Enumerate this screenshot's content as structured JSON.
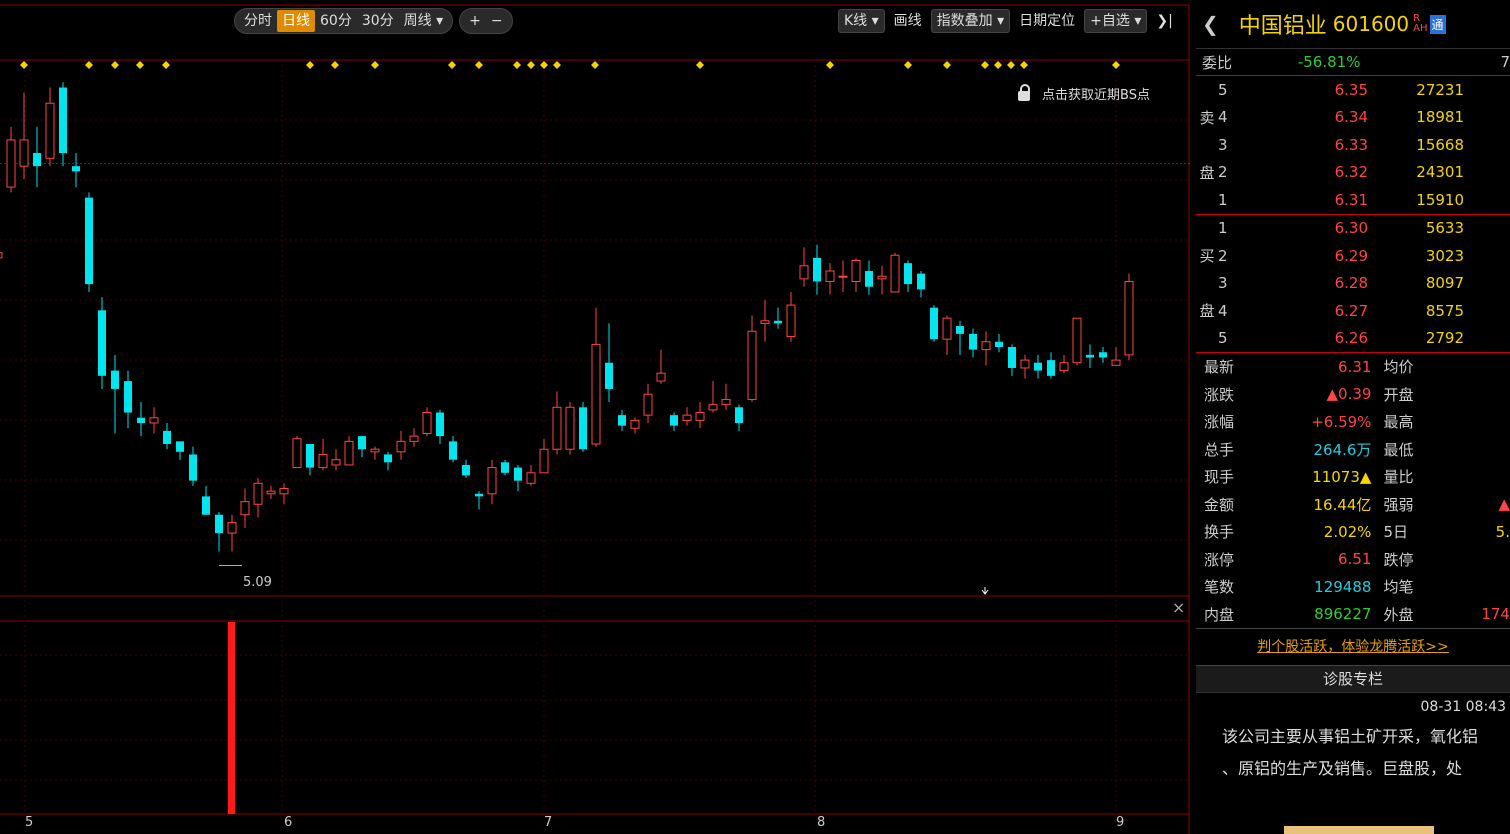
{
  "toolbar": {
    "periods": [
      "分时",
      "日线",
      "60分",
      "30分",
      "周线 ▾"
    ],
    "active_period": "日线",
    "zoom_in": "+",
    "zoom_out": "−",
    "right_buttons": [
      "K线 ▾",
      "画线",
      "指数叠加 ▾",
      "日期定位",
      "+自选 ▾",
      "❯|"
    ]
  },
  "chart": {
    "bs_hint": "点击获取近期BS点",
    "low_label": "5.09",
    "month_labels": [
      "5",
      "6",
      "7",
      "8",
      "9"
    ],
    "close_symbol": "×"
  },
  "stock": {
    "back": "❮",
    "name": "中国铝业",
    "code": "601600",
    "tag_top": "R",
    "tag_bottom": "AH",
    "tong": "通"
  },
  "weibi": {
    "label": "委比",
    "value": "-56.81%",
    "value2": "7"
  },
  "sell": [
    {
      "level": "5",
      "price": "6.35",
      "volume": "27231"
    },
    {
      "level": "4",
      "price": "6.34",
      "volume": "18981"
    },
    {
      "level": "3",
      "price": "6.33",
      "volume": "15668"
    },
    {
      "level": "2",
      "price": "6.32",
      "volume": "24301"
    },
    {
      "level": "1",
      "price": "6.31",
      "volume": "15910"
    }
  ],
  "sell_side_label": [
    "卖",
    "盘"
  ],
  "buy": [
    {
      "level": "1",
      "price": "6.30",
      "volume": "5633"
    },
    {
      "level": "2",
      "price": "6.29",
      "volume": "3023"
    },
    {
      "level": "3",
      "price": "6.28",
      "volume": "8097"
    },
    {
      "level": "4",
      "price": "6.27",
      "volume": "8575"
    },
    {
      "level": "5",
      "price": "6.26",
      "volume": "2792"
    }
  ],
  "buy_side_label": [
    "买",
    "盘"
  ],
  "stats": [
    {
      "k": "最新",
      "v": "6.31",
      "vc": "red",
      "k2": "均价",
      "v2": "",
      "v2c": "red"
    },
    {
      "k": "涨跌",
      "v": "▲0.39",
      "vc": "red",
      "k2": "开盘",
      "v2": "",
      "v2c": "red"
    },
    {
      "k": "涨幅",
      "v": "+6.59%",
      "vc": "red",
      "k2": "最高",
      "v2": "",
      "v2c": "red"
    },
    {
      "k": "总手",
      "v": "264.6万",
      "vc": "cyan",
      "k2": "最低",
      "v2": "",
      "v2c": "red"
    },
    {
      "k": "现手",
      "v": "11073▲",
      "vc": "yellow",
      "k2": "量比",
      "v2": "",
      "v2c": "red"
    },
    {
      "k": "金额",
      "v": "16.44亿",
      "vc": "yellow",
      "k2": "强弱",
      "v2": "▲",
      "v2c": "red"
    },
    {
      "k": "换手",
      "v": "2.02%",
      "vc": "yellow",
      "k2": "5日",
      "v2": "5.",
      "v2c": "yellow"
    },
    {
      "k": "涨停",
      "v": "6.51",
      "vc": "red",
      "k2": "跌停",
      "v2": "",
      "v2c": "green"
    },
    {
      "k": "笔数",
      "v": "129488",
      "vc": "cyan",
      "k2": "均笔",
      "v2": "",
      "v2c": "yellow"
    },
    {
      "k": "内盘",
      "v": "896227",
      "vc": "green",
      "k2": "外盘",
      "v2": "174",
      "v2c": "red"
    }
  ],
  "promo": "判个股活跃，体验龙腾活跃>>",
  "column": {
    "title": "诊股专栏",
    "date": "08-31 08:43",
    "lines": [
      "该公司主要从事铝土矿开采，氧化铝",
      "、原铝的生产及销售。巨盘股，处"
    ]
  },
  "chart_data": {
    "type": "candlestick",
    "candles": [
      {
        "o": 5.95,
        "c": 5.97,
        "h": 6.05,
        "l": 5.9
      },
      {
        "o": 6.22,
        "c": 6.4,
        "h": 6.45,
        "l": 6.2
      },
      {
        "o": 6.3,
        "c": 6.4,
        "h": 6.58,
        "l": 6.25
      },
      {
        "o": 6.35,
        "c": 6.3,
        "h": 6.45,
        "l": 6.22
      },
      {
        "o": 6.33,
        "c": 6.54,
        "h": 6.6,
        "l": 6.3
      },
      {
        "o": 6.6,
        "c": 6.35,
        "h": 6.62,
        "l": 6.3
      },
      {
        "o": 6.3,
        "c": 6.28,
        "h": 6.35,
        "l": 6.22
      },
      {
        "o": 6.18,
        "c": 5.85,
        "h": 6.2,
        "l": 5.82
      },
      {
        "o": 5.75,
        "c": 5.5,
        "h": 5.8,
        "l": 5.45
      },
      {
        "o": 5.52,
        "c": 5.45,
        "h": 5.58,
        "l": 5.28
      },
      {
        "o": 5.48,
        "c": 5.36,
        "h": 5.52,
        "l": 5.3
      },
      {
        "o": 5.34,
        "c": 5.32,
        "h": 5.4,
        "l": 5.27
      },
      {
        "o": 5.32,
        "c": 5.34,
        "h": 5.38,
        "l": 5.28
      },
      {
        "o": 5.29,
        "c": 5.24,
        "h": 5.32,
        "l": 5.22
      },
      {
        "o": 5.25,
        "c": 5.21,
        "h": 5.25,
        "l": 5.18
      },
      {
        "o": 5.2,
        "c": 5.1,
        "h": 5.23,
        "l": 5.08
      },
      {
        "o": 5.04,
        "c": 4.97,
        "h": 5.08,
        "l": 4.97
      },
      {
        "o": 4.97,
        "c": 4.9,
        "h": 4.98,
        "l": 4.83
      },
      {
        "o": 4.9,
        "c": 4.94,
        "h": 4.97,
        "l": 4.83
      },
      {
        "o": 4.97,
        "c": 5.02,
        "h": 5.07,
        "l": 4.92
      },
      {
        "o": 5.01,
        "c": 5.09,
        "h": 5.11,
        "l": 4.96
      },
      {
        "o": 5.05,
        "c": 5.06,
        "h": 5.08,
        "l": 5.03
      },
      {
        "o": 5.05,
        "c": 5.07,
        "h": 5.09,
        "l": 5.01
      },
      {
        "o": 5.15,
        "c": 5.26,
        "h": 5.27,
        "l": 5.15
      },
      {
        "o": 5.24,
        "c": 5.15,
        "h": 5.24,
        "l": 5.12
      },
      {
        "o": 5.15,
        "c": 5.2,
        "h": 5.26,
        "l": 5.14
      },
      {
        "o": 5.16,
        "c": 5.18,
        "h": 5.22,
        "l": 5.14
      },
      {
        "o": 5.16,
        "c": 5.25,
        "h": 5.27,
        "l": 5.16
      },
      {
        "o": 5.27,
        "c": 5.22,
        "h": 5.27,
        "l": 5.19
      },
      {
        "o": 5.21,
        "c": 5.22,
        "h": 5.23,
        "l": 5.18
      },
      {
        "o": 5.2,
        "c": 5.17,
        "h": 5.21,
        "l": 5.14
      },
      {
        "o": 5.21,
        "c": 5.25,
        "h": 5.29,
        "l": 5.18
      },
      {
        "o": 5.25,
        "c": 5.27,
        "h": 5.3,
        "l": 5.23
      },
      {
        "o": 5.28,
        "c": 5.36,
        "h": 5.38,
        "l": 5.27
      },
      {
        "o": 5.36,
        "c": 5.27,
        "h": 5.37,
        "l": 5.24
      },
      {
        "o": 5.25,
        "c": 5.18,
        "h": 5.27,
        "l": 5.17
      },
      {
        "o": 5.16,
        "c": 5.12,
        "h": 5.18,
        "l": 5.11
      },
      {
        "o": 5.05,
        "c": 5.04,
        "h": 5.06,
        "l": 4.99
      },
      {
        "o": 5.05,
        "c": 5.15,
        "h": 5.18,
        "l": 5.01
      },
      {
        "o": 5.17,
        "c": 5.13,
        "h": 5.18,
        "l": 5.12
      },
      {
        "o": 5.15,
        "c": 5.1,
        "h": 5.16,
        "l": 5.06
      },
      {
        "o": 5.09,
        "c": 5.13,
        "h": 5.16,
        "l": 5.08
      },
      {
        "o": 5.13,
        "c": 5.22,
        "h": 5.26,
        "l": 5.13
      },
      {
        "o": 5.22,
        "c": 5.38,
        "h": 5.44,
        "l": 5.2
      },
      {
        "o": 5.22,
        "c": 5.38,
        "h": 5.4,
        "l": 5.2
      },
      {
        "o": 5.38,
        "c": 5.22,
        "h": 5.4,
        "l": 5.21
      },
      {
        "o": 5.24,
        "c": 5.62,
        "h": 5.76,
        "l": 5.23
      },
      {
        "o": 5.55,
        "c": 5.45,
        "h": 5.7,
        "l": 5.4
      },
      {
        "o": 5.35,
        "c": 5.31,
        "h": 5.37,
        "l": 5.29
      },
      {
        "o": 5.3,
        "c": 5.33,
        "h": 5.34,
        "l": 5.28
      },
      {
        "o": 5.35,
        "c": 5.43,
        "h": 5.47,
        "l": 5.32
      },
      {
        "o": 5.48,
        "c": 5.51,
        "h": 5.6,
        "l": 5.47
      },
      {
        "o": 5.35,
        "c": 5.31,
        "h": 5.36,
        "l": 5.29
      },
      {
        "o": 5.33,
        "c": 5.35,
        "h": 5.38,
        "l": 5.31
      },
      {
        "o": 5.33,
        "c": 5.36,
        "h": 5.4,
        "l": 5.3
      },
      {
        "o": 5.37,
        "c": 5.39,
        "h": 5.48,
        "l": 5.36
      },
      {
        "o": 5.39,
        "c": 5.41,
        "h": 5.47,
        "l": 5.37
      },
      {
        "o": 5.38,
        "c": 5.32,
        "h": 5.39,
        "l": 5.29
      },
      {
        "o": 5.41,
        "c": 5.67,
        "h": 5.73,
        "l": 5.4
      },
      {
        "o": 5.7,
        "c": 5.71,
        "h": 5.79,
        "l": 5.63
      },
      {
        "o": 5.71,
        "c": 5.7,
        "h": 5.76,
        "l": 5.68
      },
      {
        "o": 5.65,
        "c": 5.77,
        "h": 5.82,
        "l": 5.63
      },
      {
        "o": 5.87,
        "c": 5.92,
        "h": 5.99,
        "l": 5.84
      },
      {
        "o": 5.95,
        "c": 5.86,
        "h": 6.0,
        "l": 5.81
      },
      {
        "o": 5.86,
        "c": 5.9,
        "h": 5.93,
        "l": 5.81
      },
      {
        "o": 5.88,
        "c": 5.88,
        "h": 5.94,
        "l": 5.82
      },
      {
        "o": 5.86,
        "c": 5.94,
        "h": 5.95,
        "l": 5.82
      },
      {
        "o": 5.9,
        "c": 5.84,
        "h": 5.94,
        "l": 5.81
      },
      {
        "o": 5.87,
        "c": 5.88,
        "h": 5.92,
        "l": 5.81
      },
      {
        "o": 5.82,
        "c": 5.96,
        "h": 5.97,
        "l": 5.82
      },
      {
        "o": 5.93,
        "c": 5.85,
        "h": 5.94,
        "l": 5.82
      },
      {
        "o": 5.89,
        "c": 5.83,
        "h": 5.9,
        "l": 5.8
      },
      {
        "o": 5.76,
        "c": 5.64,
        "h": 5.77,
        "l": 5.63
      },
      {
        "o": 5.64,
        "c": 5.72,
        "h": 5.73,
        "l": 5.58
      },
      {
        "o": 5.69,
        "c": 5.66,
        "h": 5.71,
        "l": 5.58
      },
      {
        "o": 5.66,
        "c": 5.6,
        "h": 5.68,
        "l": 5.57
      },
      {
        "o": 5.6,
        "c": 5.63,
        "h": 5.67,
        "l": 5.54
      },
      {
        "o": 5.63,
        "c": 5.61,
        "h": 5.66,
        "l": 5.59
      },
      {
        "o": 5.61,
        "c": 5.53,
        "h": 5.62,
        "l": 5.5
      },
      {
        "o": 5.53,
        "c": 5.56,
        "h": 5.58,
        "l": 5.49
      },
      {
        "o": 5.55,
        "c": 5.52,
        "h": 5.58,
        "l": 5.49
      },
      {
        "o": 5.56,
        "c": 5.5,
        "h": 5.59,
        "l": 5.49
      },
      {
        "o": 5.52,
        "c": 5.55,
        "h": 5.58,
        "l": 5.51
      },
      {
        "o": 5.55,
        "c": 5.72,
        "h": 5.72,
        "l": 5.54
      },
      {
        "o": 5.58,
        "c": 5.57,
        "h": 5.62,
        "l": 5.53
      },
      {
        "o": 5.59,
        "c": 5.57,
        "h": 5.61,
        "l": 5.55
      },
      {
        "o": 5.54,
        "c": 5.56,
        "h": 5.61,
        "l": 5.54
      },
      {
        "o": 5.58,
        "c": 5.86,
        "h": 5.89,
        "l": 5.56
      }
    ]
  }
}
